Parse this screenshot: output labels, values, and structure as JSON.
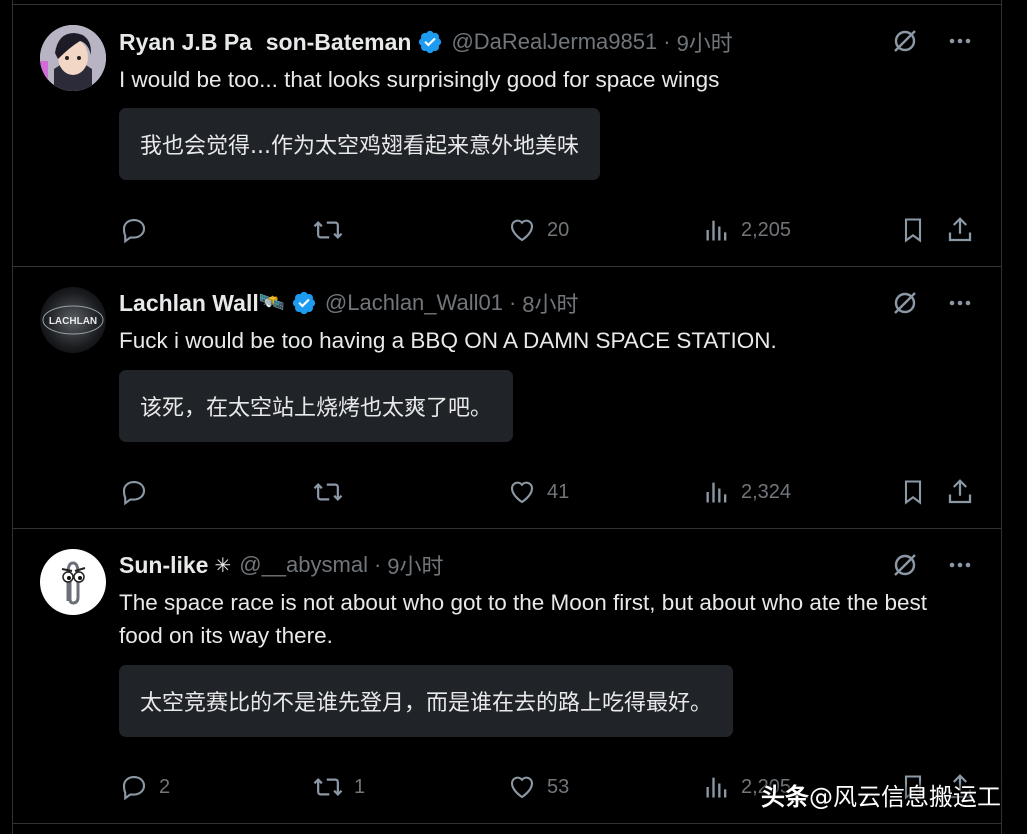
{
  "colors": {
    "background": "#000000",
    "text": "#e7e9ea",
    "muted": "#71767b",
    "verified": "#1d9bf0",
    "translation_bg": "#202327",
    "divider": "#2f3336"
  },
  "tweets": [
    {
      "name": "Ryan J.B Pa   son-Bateman",
      "verified": true,
      "handle": "@DaRealJerma9851",
      "separator": "·",
      "time": "9小时",
      "text": "I would be too... that looks surprisingly good for space wings",
      "translation": "我也会觉得...作为太空鸡翅看起来意外地美味",
      "replies": "",
      "reposts": "",
      "likes": "20",
      "views": "2,205",
      "icons": [
        "grok-icon",
        "more-icon",
        "reply-icon",
        "repost-icon",
        "like-icon",
        "views-icon",
        "bookmark-icon",
        "share-icon"
      ]
    },
    {
      "name": "Lachlan Wall",
      "name_emoji": "🛰️",
      "verified": true,
      "handle": "@Lachlan_Wall01",
      "separator": "·",
      "time": "8小时",
      "avatar_text": "LACHLAN",
      "text": "Fuck i would be too having a BBQ ON A DAMN SPACE STATION.",
      "translation": "该死，在太空站上烧烤也太爽了吧。",
      "replies": "",
      "reposts": "",
      "likes": "41",
      "views": "2,324"
    },
    {
      "name": "Sun-like",
      "name_emoji": "✳",
      "verified": false,
      "handle": "@__abysmal",
      "separator": "·",
      "time": "9小时",
      "text": "The space race is not about who got to the Moon first, but about who ate the best food on its way there.",
      "translation": "太空竞赛比的不是谁先登月，而是谁在去的路上吃得最好。",
      "replies": "2",
      "reposts": "1",
      "likes": "53",
      "views": "2,205"
    }
  ],
  "watermark": {
    "brand": "头条",
    "account": "@风云信息搬运工"
  }
}
